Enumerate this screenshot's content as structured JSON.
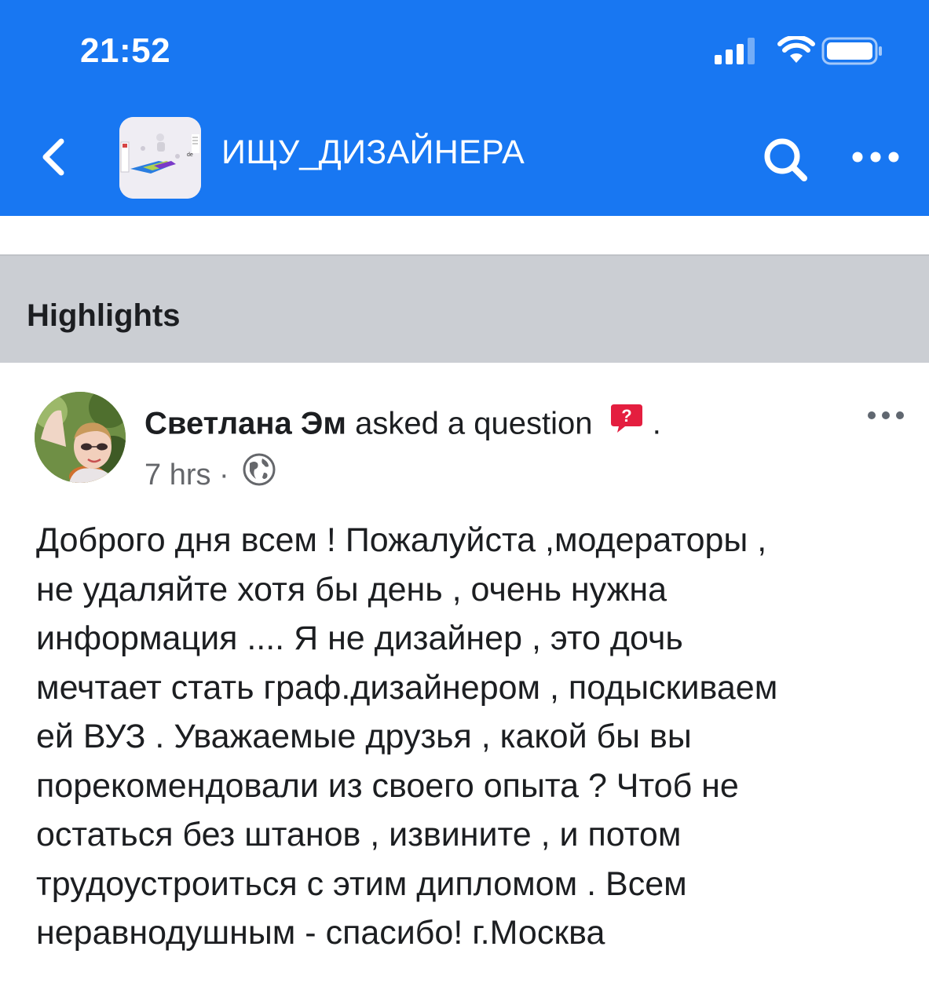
{
  "status_bar": {
    "time": "21:52",
    "icons": [
      "signal-icon",
      "wifi-icon",
      "battery-icon"
    ]
  },
  "nav": {
    "back_icon": "chevron-left-icon",
    "group_title": "ИЩУ_ДИЗАЙНЕРА",
    "search_icon": "search-icon",
    "more_icon": "more-horizontal-icon"
  },
  "section": {
    "title": "Highlights"
  },
  "post": {
    "author": "Светлана Эм",
    "action": "asked a question",
    "trailing": ".",
    "time": "7 hrs",
    "separator": "·",
    "audience_icon": "globe-icon",
    "more_icon": "more-horizontal-icon",
    "text": "Доброго дня всем ! Пожалуйста ,модераторы ,\nне удаляйте хотя бы день , очень нужна\nинформация .... Я не дизайнер , это дочь\nмечтает стать граф.дизайнером , подыскиваем\nей ВУЗ . Уважаемые друзья , какой бы вы\nпорекомендовали из своего опыта ? Чтоб не\nостаться без штанов , извините , и потом\nтрудоустроиться с этим дипломом . Всем\nнеравнодушным - спасибо! г.Москва"
  },
  "colors": {
    "brand_blue": "#1877f2",
    "section_gray": "#cbced3",
    "text_primary": "#1c1e21",
    "text_secondary": "#65676b",
    "question_badge": "#e41e3f"
  }
}
